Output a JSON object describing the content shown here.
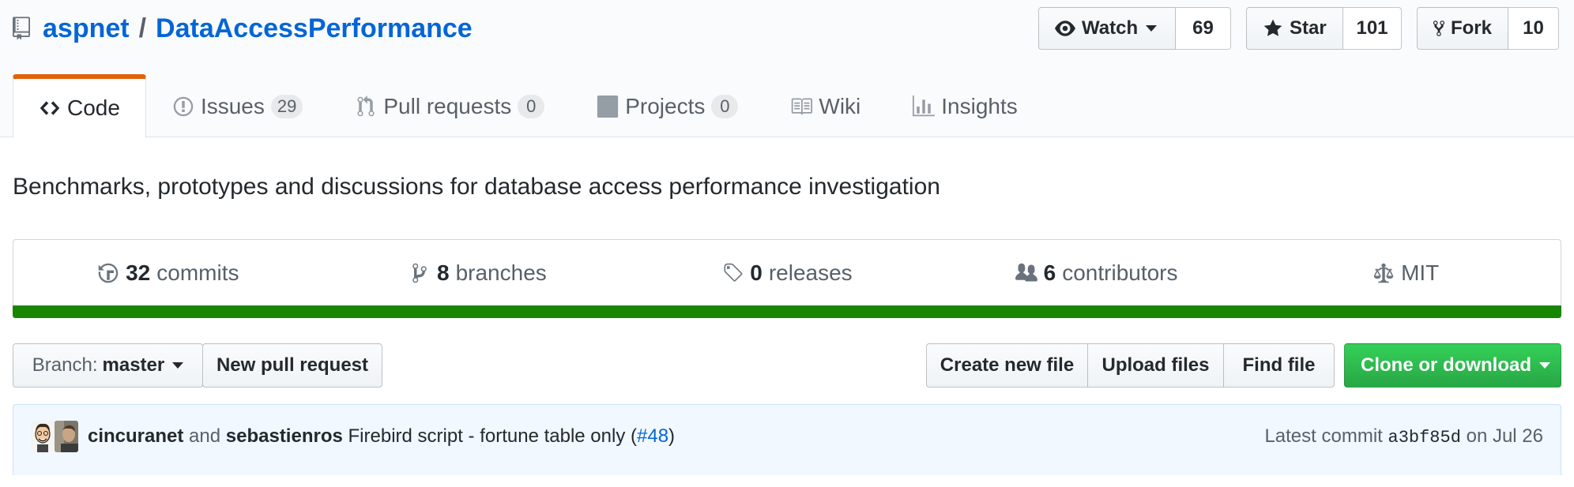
{
  "repo": {
    "owner": "aspnet",
    "separator": "/",
    "name": "DataAccessPerformance",
    "description": "Benchmarks, prototypes and discussions for database access performance investigation"
  },
  "actions": {
    "watch": {
      "label": "Watch",
      "count": "69"
    },
    "star": {
      "label": "Star",
      "count": "101"
    },
    "fork": {
      "label": "Fork",
      "count": "10"
    }
  },
  "nav": {
    "code": {
      "label": "Code"
    },
    "issues": {
      "label": "Issues",
      "count": "29"
    },
    "pulls": {
      "label": "Pull requests",
      "count": "0"
    },
    "projects": {
      "label": "Projects",
      "count": "0"
    },
    "wiki": {
      "label": "Wiki"
    },
    "insights": {
      "label": "Insights"
    }
  },
  "summary": {
    "commits": {
      "num": "32",
      "label": "commits"
    },
    "branches": {
      "num": "8",
      "label": "branches"
    },
    "releases": {
      "num": "0",
      "label": "releases"
    },
    "contributors": {
      "num": "6",
      "label": "contributors"
    },
    "license": {
      "label": "MIT"
    },
    "language_color": "#178600"
  },
  "file_nav": {
    "branch_prefix": "Branch:",
    "branch_name": "master",
    "new_pull_request": "New pull request",
    "create_new_file": "Create new file",
    "upload_files": "Upload files",
    "find_file": "Find file",
    "clone_or_download": "Clone or download"
  },
  "commit": {
    "author1": "cincuranet",
    "and": "and",
    "author2": "sebastienros",
    "message": "Firebird script - fortune table only (",
    "pr_link": "#48",
    "message_end": ")",
    "latest_label": "Latest commit",
    "sha": "a3bf85d",
    "date": "on Jul 26"
  },
  "colors": {
    "link": "#0366d6",
    "selected_tab": "#e36209",
    "primary_button": "#28a745"
  }
}
